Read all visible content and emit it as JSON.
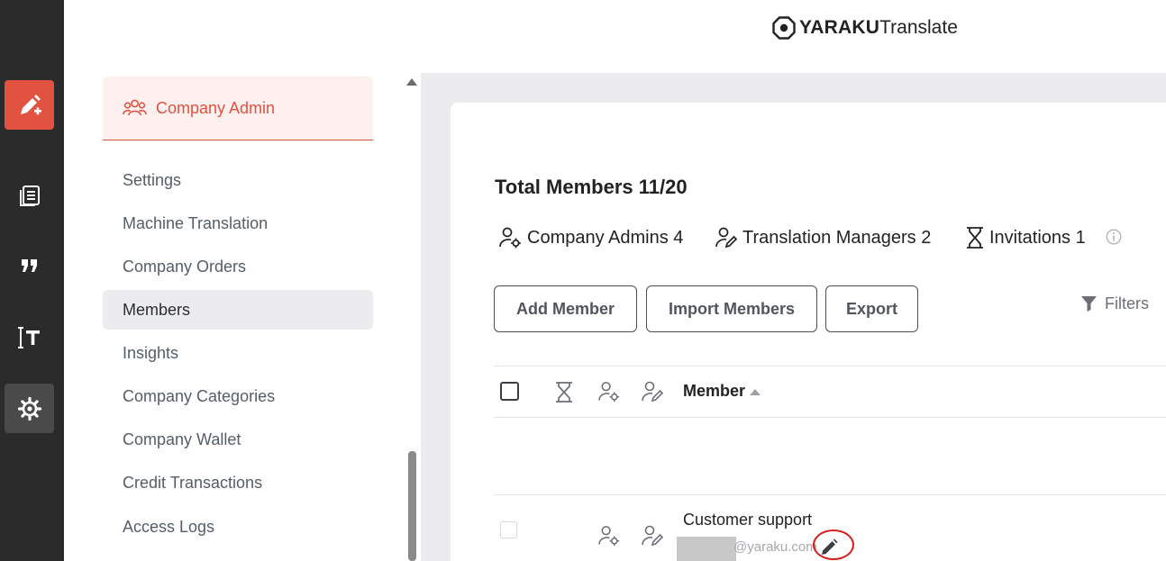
{
  "brand": {
    "name": "YARAKU",
    "product": "Translate"
  },
  "rail": {
    "items": [
      {
        "name": "translate-editor",
        "icon": "pencil-plus-icon",
        "state": "active"
      },
      {
        "name": "documents",
        "icon": "documents-icon",
        "state": "normal"
      },
      {
        "name": "quotes",
        "icon": "quote-icon",
        "state": "normal"
      },
      {
        "name": "text-size",
        "icon": "text-cursor-icon",
        "state": "normal"
      },
      {
        "name": "settings",
        "icon": "gear-icon",
        "state": "selected"
      }
    ]
  },
  "sidebar": {
    "header": "Company Admin",
    "items": [
      {
        "label": "Settings"
      },
      {
        "label": "Machine Translation"
      },
      {
        "label": "Company Orders"
      },
      {
        "label": "Members",
        "current": true
      },
      {
        "label": "Insights"
      },
      {
        "label": "Company Categories"
      },
      {
        "label": "Company Wallet"
      },
      {
        "label": "Credit Transactions"
      },
      {
        "label": "Access Logs"
      }
    ]
  },
  "members": {
    "total_label": "Total Members 11/20",
    "stats": {
      "company_admins": "Company Admins 4",
      "translation_managers": "Translation Managers 2",
      "invitations": "Invitations 1"
    },
    "actions": {
      "add": "Add Member",
      "import": "Import Members",
      "export": "Export",
      "filters": "Filters"
    },
    "table": {
      "member_column": "Member",
      "sort": "ascending"
    },
    "rows": [
      {
        "name": "Customer support",
        "email": "@yaraku.com"
      }
    ]
  },
  "colors": {
    "accent": "#e15241",
    "rail_bg": "#2b2b2b",
    "highlight_ring": "#d81b1b"
  }
}
